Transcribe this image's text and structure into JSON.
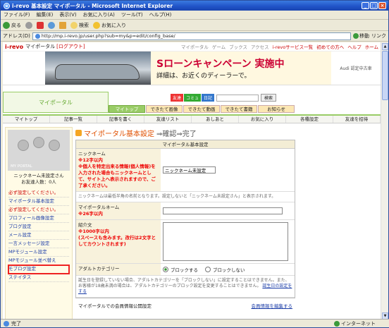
{
  "window": {
    "title": "i-revo 基本設定 マイポータル - Microsoft Internet Explorer",
    "minimize": "_",
    "maximize": "□",
    "close": "×"
  },
  "menu": [
    "ファイル(F)",
    "編集(E)",
    "表示(V)",
    "お気に入り(A)",
    "ツール(T)",
    "ヘルプ(H)"
  ],
  "toolbar": {
    "back": "戻る",
    "forward": "",
    "search": "検索",
    "favorites": "お気に入り"
  },
  "address": {
    "label": "アドレス(D)",
    "url": "http://mp.i-revo.jp/user.php?sub=my&p=edit/config_base/",
    "go": "移動",
    "links": "リンク"
  },
  "site": {
    "logo": "i-revo",
    "title": "マイポータル",
    "login": "[ログアウト]",
    "links": [
      "マイポータル",
      "ゲーム",
      "ブックス",
      "アクセス",
      "i-revoサービス一覧",
      "初めての方へ",
      "ヘルプ",
      "ホーム"
    ]
  },
  "banner": {
    "line1": "Sローンキャンペーン 実施中",
    "line2": "詳細は、お近くのディーラーで。",
    "brand": "Audi 認定中古車"
  },
  "portal_tab": "マイポータル",
  "search": {
    "buttons": [
      "友達",
      "コミュ",
      "日記"
    ],
    "button_colors": [
      "#e33",
      "#3a3",
      "#37c"
    ],
    "go": "検索"
  },
  "main_tabs": [
    {
      "label": "マイトップ",
      "active": true
    },
    {
      "label": "できたて画像",
      "active": false
    },
    {
      "label": "できたて動画",
      "active": false
    },
    {
      "label": "できたて書籍",
      "active": false
    },
    {
      "label": "お知らせ",
      "active": false
    }
  ],
  "sub_nav": [
    "マイトップ",
    "記事一覧",
    "記事を書く",
    "友達リスト",
    "あしあと",
    "お気に入り",
    "各種設定",
    "友達を招待"
  ],
  "sidebar": {
    "avatar_label": "MY PORTAL",
    "nickname": "ニックネーム未設定さん",
    "friends": "お友達人数：0人",
    "items": [
      {
        "label": "必ず設定してください。",
        "style": "red"
      },
      {
        "label": "マイポータル基本設定",
        "style": "blue"
      },
      {
        "label": "必ず設定してください。",
        "style": "red"
      },
      {
        "label": "プロフィール画像設定",
        "style": "blue"
      },
      {
        "label": "ブログ設定",
        "style": "blue"
      },
      {
        "label": "メール設定",
        "style": "blue"
      },
      {
        "label": "一言メッセージ設定",
        "style": "blue"
      },
      {
        "label": "MPモジュール設定",
        "style": "blue"
      },
      {
        "label": "MPモジュール並べ替え",
        "style": "blue"
      },
      {
        "label": "モブログ設定",
        "style": "hl"
      },
      {
        "label": "ステイタス",
        "style": "blue"
      }
    ]
  },
  "content": {
    "title_main": "マイポータル基本設定",
    "title_arrow": "⇒確認⇒完了",
    "form_header": "マイポータル基本設定",
    "nickname": {
      "label": "ニックネーム",
      "rule": "※12字以内",
      "warn": "※個人を特定出来る情報(個人情報)を入力された場合もニックネームとして、サイト上へ表示されますので、ご了承ください。",
      "value": "ニックネーム未設定"
    },
    "nickname_note": "ニックネームは最低半角の名前となります。設定しないと「ニックネーム未設定さん」と表示されます。",
    "portal_name": {
      "label": "マイポータルネーム",
      "rule": "※26字以内",
      "value": ""
    },
    "intro": {
      "label": "紹介文",
      "rule": "※1000字以内",
      "warn": "(スペースも含みます。改行は2文字としてカウントされます)"
    },
    "adult": {
      "label": "アダルトカテゴリー",
      "options": [
        "ブロックする",
        "ブロックしない"
      ],
      "selected": "ブロックする"
    },
    "adult_note": "誕生日を登録していない場合、アダルトカテゴリーを「ブロックしない」に設定することはできません。また、お客様が18歳未満の場合は、アダルトカテゴリーのブロック設定を変更することはできません。",
    "adult_link": "誕生日の設定をする",
    "section2": "マイポータルでの会員情報公開設定",
    "section2_link": "会員情報を編集する"
  },
  "status": {
    "left": "完了",
    "zone": "インターネット"
  }
}
